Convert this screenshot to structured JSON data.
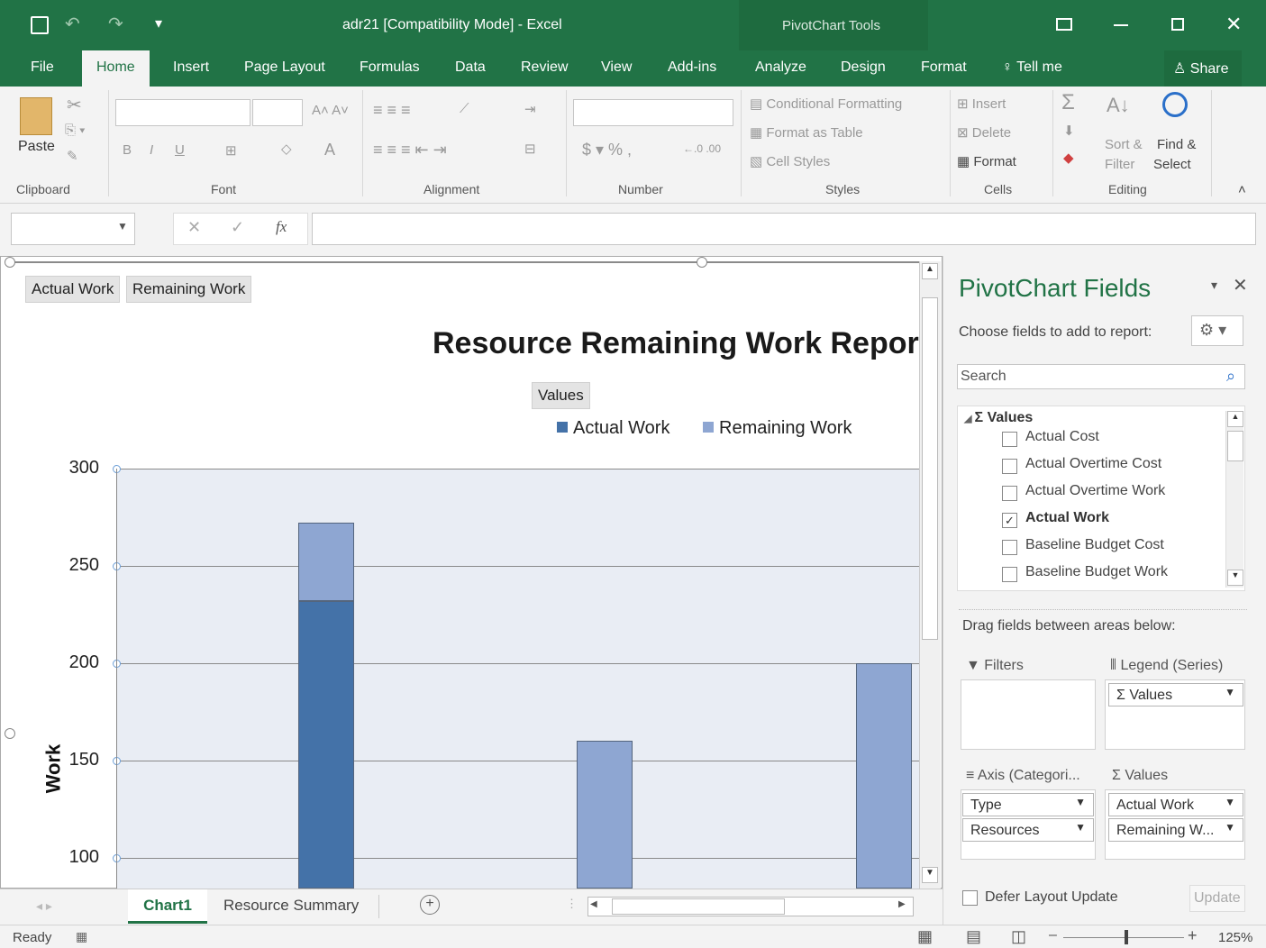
{
  "window": {
    "title": "adr21  [Compatibility Mode] - Excel",
    "context_title": "PivotChart Tools"
  },
  "tabs": [
    "File",
    "Home",
    "Insert",
    "Page Layout",
    "Formulas",
    "Data",
    "Review",
    "View",
    "Add-ins",
    "Analyze",
    "Design",
    "Format"
  ],
  "tellme": "Tell me",
  "share": "Share",
  "ribbon": {
    "paste": "Paste",
    "groups": {
      "clipboard": "Clipboard",
      "font": "Font",
      "alignment": "Alignment",
      "number": "Number",
      "styles": "Styles",
      "cells": "Cells",
      "editing": "Editing"
    },
    "styles": {
      "conditional": "Conditional Formatting",
      "table": "Format as Table",
      "cell": "Cell Styles"
    },
    "cells": {
      "insert": "Insert",
      "delete": "Delete",
      "format": "Format"
    },
    "editing": {
      "sort1": "Sort &",
      "sort2": "Filter",
      "find1": "Find &",
      "find2": "Select"
    }
  },
  "chart": {
    "field_buttons": [
      "Actual Work",
      "Remaining Work"
    ],
    "values_button": "Values",
    "title": "Resource Remaining Work Report",
    "legend": [
      "Actual Work",
      "Remaining Work"
    ],
    "ylabel": "Work"
  },
  "chart_data": {
    "type": "bar",
    "stacked": true,
    "title": "Resource Remaining Work Report",
    "ylabel": "Work",
    "ylim_visible": [
      80,
      300
    ],
    "yticks": [
      100,
      150,
      200,
      250,
      300
    ],
    "series": [
      {
        "name": "Actual Work",
        "values": [
          232,
          0,
          0
        ],
        "color": "#4472a8"
      },
      {
        "name": "Remaining Work",
        "values": [
          40,
          160,
          200
        ],
        "color": "#8ea6d2"
      }
    ]
  },
  "sheets": {
    "active": "Chart1",
    "other": "Resource Summary"
  },
  "panel": {
    "title": "PivotChart Fields",
    "subtitle": "Choose fields to add to report:",
    "search_placeholder": "Search",
    "values_group": "Values",
    "fields": [
      {
        "label": "Actual Cost",
        "checked": false
      },
      {
        "label": "Actual Overtime Cost",
        "checked": false
      },
      {
        "label": "Actual Overtime Work",
        "checked": false
      },
      {
        "label": "Actual Work",
        "checked": true
      },
      {
        "label": "Baseline Budget Cost",
        "checked": false
      },
      {
        "label": "Baseline Budget Work",
        "checked": false
      }
    ],
    "drag_label": "Drag fields between areas below:",
    "filters": "Filters",
    "legend": "Legend (Series)",
    "legend_item": "Values",
    "axis": "Axis (Categori...",
    "values": "Values",
    "axis_items": [
      "Type",
      "Resources"
    ],
    "value_items": [
      "Actual Work",
      "Remaining W..."
    ],
    "defer": "Defer Layout Update",
    "update": "Update"
  },
  "status": {
    "ready": "Ready",
    "zoom": "125%"
  }
}
